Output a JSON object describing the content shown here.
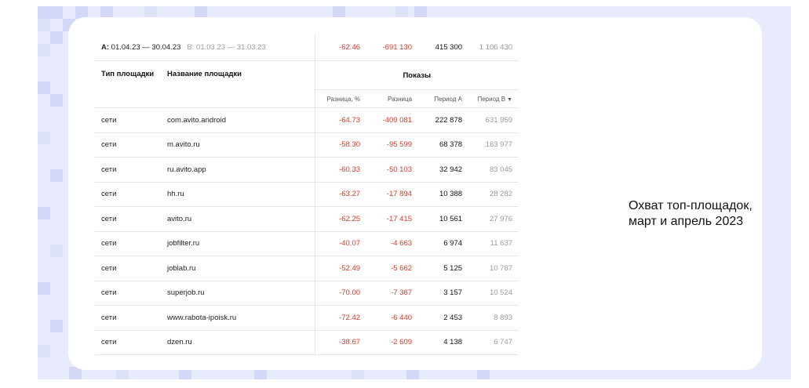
{
  "header": {
    "period_a_label": "A:",
    "period_a_value": "01.04.23 — 30.04.23",
    "period_b_label": "B:",
    "period_b_value": "01.03.23 — 31.03.23",
    "total_diff_pct": "-62.46",
    "total_diff": "-691 130",
    "total_period_a": "415 300",
    "total_period_b": "1 106 430"
  },
  "columns": {
    "type": "Тип площадки",
    "name": "Название площадки",
    "group": "Показы",
    "diff_pct": "Разница, %",
    "diff": "Разница",
    "period_a": "Период А",
    "period_b": "Период В",
    "sort_icon": "▼"
  },
  "rows": [
    {
      "type": "сети",
      "name": "com.avito.android",
      "diff_pct": "-64.73",
      "diff": "-409 081",
      "a": "222 878",
      "b": "631 959"
    },
    {
      "type": "сети",
      "name": "m.avito.ru",
      "diff_pct": "-58.30",
      "diff": "-95 599",
      "a": "68 378",
      "b": "163 977"
    },
    {
      "type": "сети",
      "name": "ru.avito.app",
      "diff_pct": "-60.33",
      "diff": "-50 103",
      "a": "32 942",
      "b": "83 045"
    },
    {
      "type": "сети",
      "name": "hh.ru",
      "diff_pct": "-63.27",
      "diff": "-17 894",
      "a": "10 388",
      "b": "28 282"
    },
    {
      "type": "сети",
      "name": "avito.ru",
      "diff_pct": "-62.25",
      "diff": "-17 415",
      "a": "10 561",
      "b": "27 976"
    },
    {
      "type": "сети",
      "name": "jobfilter.ru",
      "diff_pct": "-40.07",
      "diff": "-4 663",
      "a": "6 974",
      "b": "11 637"
    },
    {
      "type": "сети",
      "name": "joblab.ru",
      "diff_pct": "-52.49",
      "diff": "-5 662",
      "a": "5 125",
      "b": "10 787"
    },
    {
      "type": "сети",
      "name": "superjob.ru",
      "diff_pct": "-70.00",
      "diff": "-7 367",
      "a": "3 157",
      "b": "10 524"
    },
    {
      "type": "сети",
      "name": "www.rabota-ipoisk.ru",
      "diff_pct": "-72.42",
      "diff": "-6 440",
      "a": "2 453",
      "b": "8 893"
    },
    {
      "type": "сети",
      "name": "dzen.ru",
      "diff_pct": "-38.67",
      "diff": "-2 609",
      "a": "4 138",
      "b": "6 747"
    }
  ],
  "caption": {
    "line1": "Охват топ-площадок,",
    "line2": "март и апрель 2023"
  },
  "colors": {
    "background": "#e8ebfb",
    "negative": "#d43b2b",
    "muted": "#9a9a9a"
  }
}
